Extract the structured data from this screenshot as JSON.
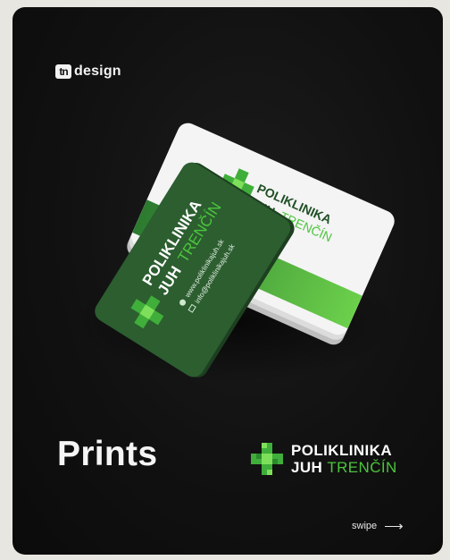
{
  "brand": {
    "mark": "tn",
    "text": "design"
  },
  "card_back": {
    "line1": "POLIKLINIKA",
    "line2_a": "JUH",
    "line2_b": "TRENČÍN"
  },
  "card_front": {
    "line1": "POLIKLINIKA",
    "line2_a": "JUH",
    "line2_b": "TRENČÍN",
    "web": "www.poliklinikajuh.sk",
    "email": "info@poliklinikajuh.sk"
  },
  "heading": "Prints",
  "logo": {
    "line1": "POLIKLINIKA",
    "line2_a": "JUH",
    "line2_b": "TRENČÍN"
  },
  "swipe": {
    "label": "swipe",
    "arrow": "⟶"
  },
  "colors": {
    "accent_green": "#4cc53c",
    "card_dark_green": "#2c5e30",
    "background": "#111111"
  },
  "icons": [
    "globe-icon",
    "mail-icon",
    "pixel-cross-icon"
  ]
}
